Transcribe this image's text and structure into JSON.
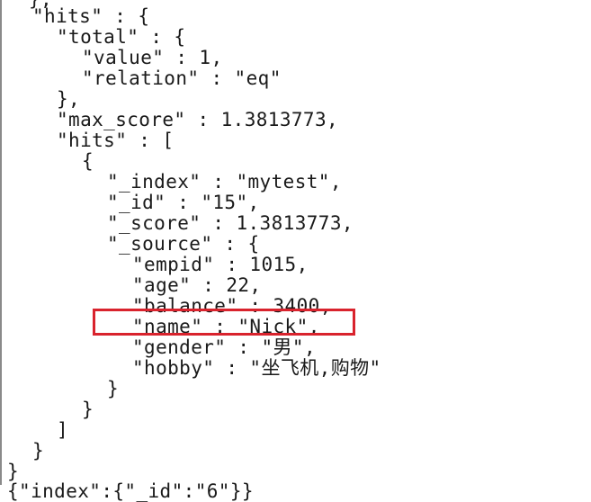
{
  "terminal": {
    "lines": [
      "},",
      "\"hits\" : {",
      "\"total\" : {",
      "\"value\" : 1,",
      "\"relation\" : \"eq\"",
      "},",
      "\"max_score\" : 1.3813773,",
      "\"hits\" : [",
      "{",
      "\"_index\" : \"mytest\",",
      "\"_id\" : \"15\",",
      "\"_score\" : 1.3813773,",
      "\"_source\" : {",
      "\"empid\" : 1015,",
      "\"age\" : 22,",
      "\"balance\" : 3400,",
      "\"name\" : \"Nick\",",
      "\"gender\" : \"男\",",
      "\"hobby\" : \"坐飞机,购物\"",
      "}",
      "}",
      "]",
      "}",
      "}",
      "{\"index\":{\"_id\":\"6\"}}"
    ]
  },
  "annotation": {
    "color": "#d9232d"
  }
}
